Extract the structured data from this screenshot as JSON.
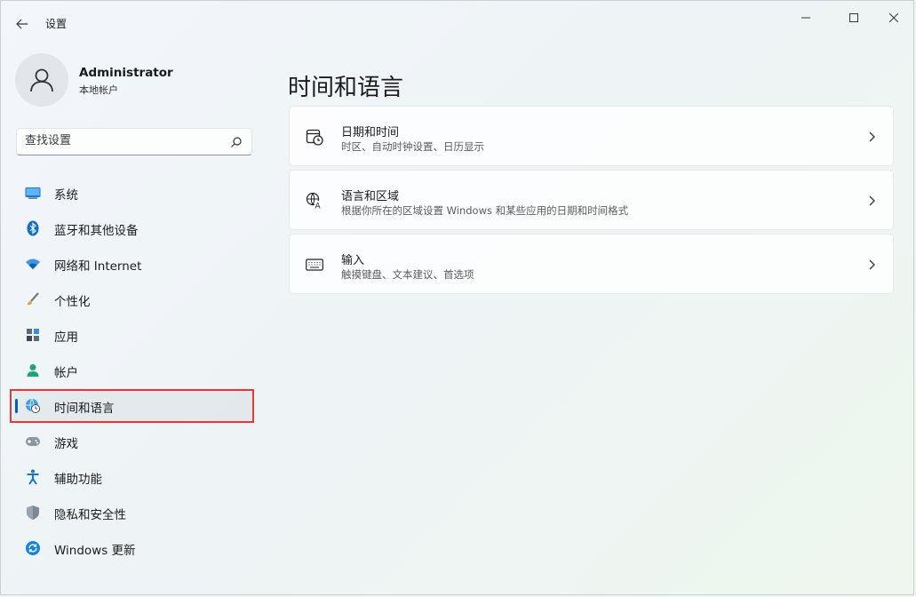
{
  "window": {
    "title": "设置"
  },
  "profile": {
    "name": "Administrator",
    "account_type": "本地帐户"
  },
  "search": {
    "placeholder": "查找设置"
  },
  "nav": {
    "items": [
      {
        "label": "系统",
        "icon": "monitor-icon"
      },
      {
        "label": "蓝牙和其他设备",
        "icon": "bluetooth-icon"
      },
      {
        "label": "网络和 Internet",
        "icon": "wifi-icon"
      },
      {
        "label": "个性化",
        "icon": "brush-icon"
      },
      {
        "label": "应用",
        "icon": "apps-icon"
      },
      {
        "label": "帐户",
        "icon": "person-icon"
      },
      {
        "label": "时间和语言",
        "icon": "globe-clock-icon",
        "selected": true
      },
      {
        "label": "游戏",
        "icon": "gamepad-icon"
      },
      {
        "label": "辅助功能",
        "icon": "accessibility-icon"
      },
      {
        "label": "隐私和安全性",
        "icon": "shield-icon"
      },
      {
        "label": "Windows 更新",
        "icon": "update-icon"
      }
    ]
  },
  "main": {
    "title": "时间和语言",
    "cards": [
      {
        "title": "日期和时间",
        "subtitle": "时区、自动时钟设置、日历显示",
        "icon": "calendar-clock-icon"
      },
      {
        "title": "语言和区域",
        "subtitle": "根据你所在的区域设置 Windows 和某些应用的日期和时间格式",
        "icon": "language-icon"
      },
      {
        "title": "输入",
        "subtitle": "触摸键盘、文本建议、首选项",
        "icon": "keyboard-icon"
      }
    ]
  },
  "colors": {
    "accent": "#005fb8",
    "highlight_box": "#e53935"
  }
}
